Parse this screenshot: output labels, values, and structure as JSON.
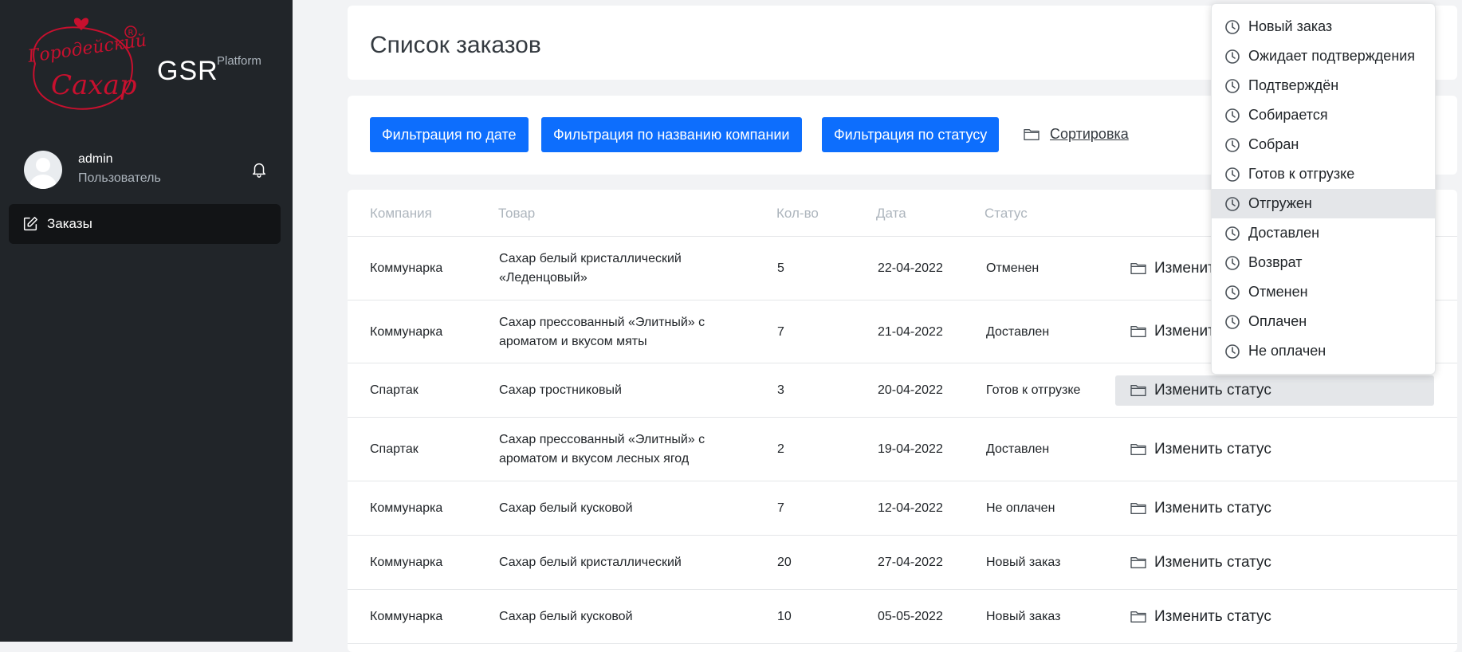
{
  "brand": {
    "name": "GSR",
    "sub": "Platform",
    "logo_text": "Городейский Сахар"
  },
  "user": {
    "name": "admin",
    "role": "Пользователь"
  },
  "sidebar": {
    "items": [
      {
        "label": "Заказы",
        "icon": "edit-icon"
      }
    ]
  },
  "page": {
    "title": "Список заказов"
  },
  "filters": {
    "by_date": "Фильтрация по дате",
    "by_company": "Фильтрация по названию компании",
    "by_status": "Фильтрация по статусу",
    "sort": "Сортировка"
  },
  "table": {
    "headers": {
      "company": "Компания",
      "product": "Товар",
      "qty": "Кол-во",
      "date": "Дата",
      "status": "Статус"
    },
    "action_label": "Изменить статус",
    "rows": [
      {
        "company": "Коммунарка",
        "product_1": "Сахар белый кристаллический",
        "product_2": "«Леденцовый»",
        "qty": "5",
        "date": "22-04-2022",
        "status": "Отменен"
      },
      {
        "company": "Коммунарка",
        "product_1": "Сахар прессованный «Элитный» с",
        "product_2": "ароматом и вкусом мяты",
        "qty": "7",
        "date": "21-04-2022",
        "status": "Доставлен"
      },
      {
        "company": "Спартак",
        "product_1": "Сахар тростниковый",
        "product_2": "",
        "qty": "3",
        "date": "20-04-2022",
        "status": "Готов к отгрузке"
      },
      {
        "company": "Спартак",
        "product_1": "Сахар прессованный «Элитный» с",
        "product_2": "ароматом и вкусом лесных ягод",
        "qty": "2",
        "date": "19-04-2022",
        "status": "Доставлен"
      },
      {
        "company": "Коммунарка",
        "product_1": "Сахар белый кусковой",
        "product_2": "",
        "qty": "7",
        "date": "12-04-2022",
        "status": "Не оплачен"
      },
      {
        "company": "Коммунарка",
        "product_1": "Сахар белый кристаллический",
        "product_2": "",
        "qty": "20",
        "date": "27-04-2022",
        "status": "Новый заказ"
      },
      {
        "company": "Коммунарка",
        "product_1": "Сахар белый кусковой",
        "product_2": "",
        "qty": "10",
        "date": "05-05-2022",
        "status": "Новый заказ"
      }
    ]
  },
  "status_menu": {
    "items": [
      "Новый заказ",
      "Ожидает подтверждения",
      "Подтверждён",
      "Собирается",
      "Собран",
      "Готов к отгрузке",
      "Отгружен",
      "Доставлен",
      "Возврат",
      "Отменен",
      "Оплачен",
      "Не оплачен"
    ],
    "active": "Отгружен"
  },
  "colors": {
    "sidebar": "#212529",
    "primary": "#0d6efd",
    "logo_red": "#c8102e"
  }
}
